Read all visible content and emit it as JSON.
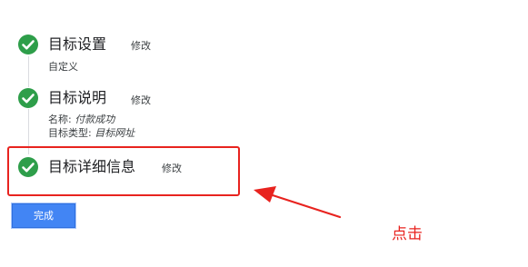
{
  "steps": [
    {
      "title": "目标设置",
      "edit_label": "修改",
      "detail": "自定义"
    },
    {
      "title": "目标说明",
      "edit_label": "修改",
      "name_label": "名称:",
      "name_value": "付款成功",
      "type_label": "目标类型:",
      "type_value": "目标网址"
    },
    {
      "title": "目标详细信息",
      "edit_label": "修改"
    }
  ],
  "done_button_label": "完成",
  "annotation": {
    "text": "点击",
    "color": "#e8231f"
  },
  "colors": {
    "check_green": "#2e9e4a",
    "button_blue": "#4285f4"
  },
  "icons": {
    "step_complete": "check-circle-icon",
    "pointer": "arrow-icon"
  }
}
